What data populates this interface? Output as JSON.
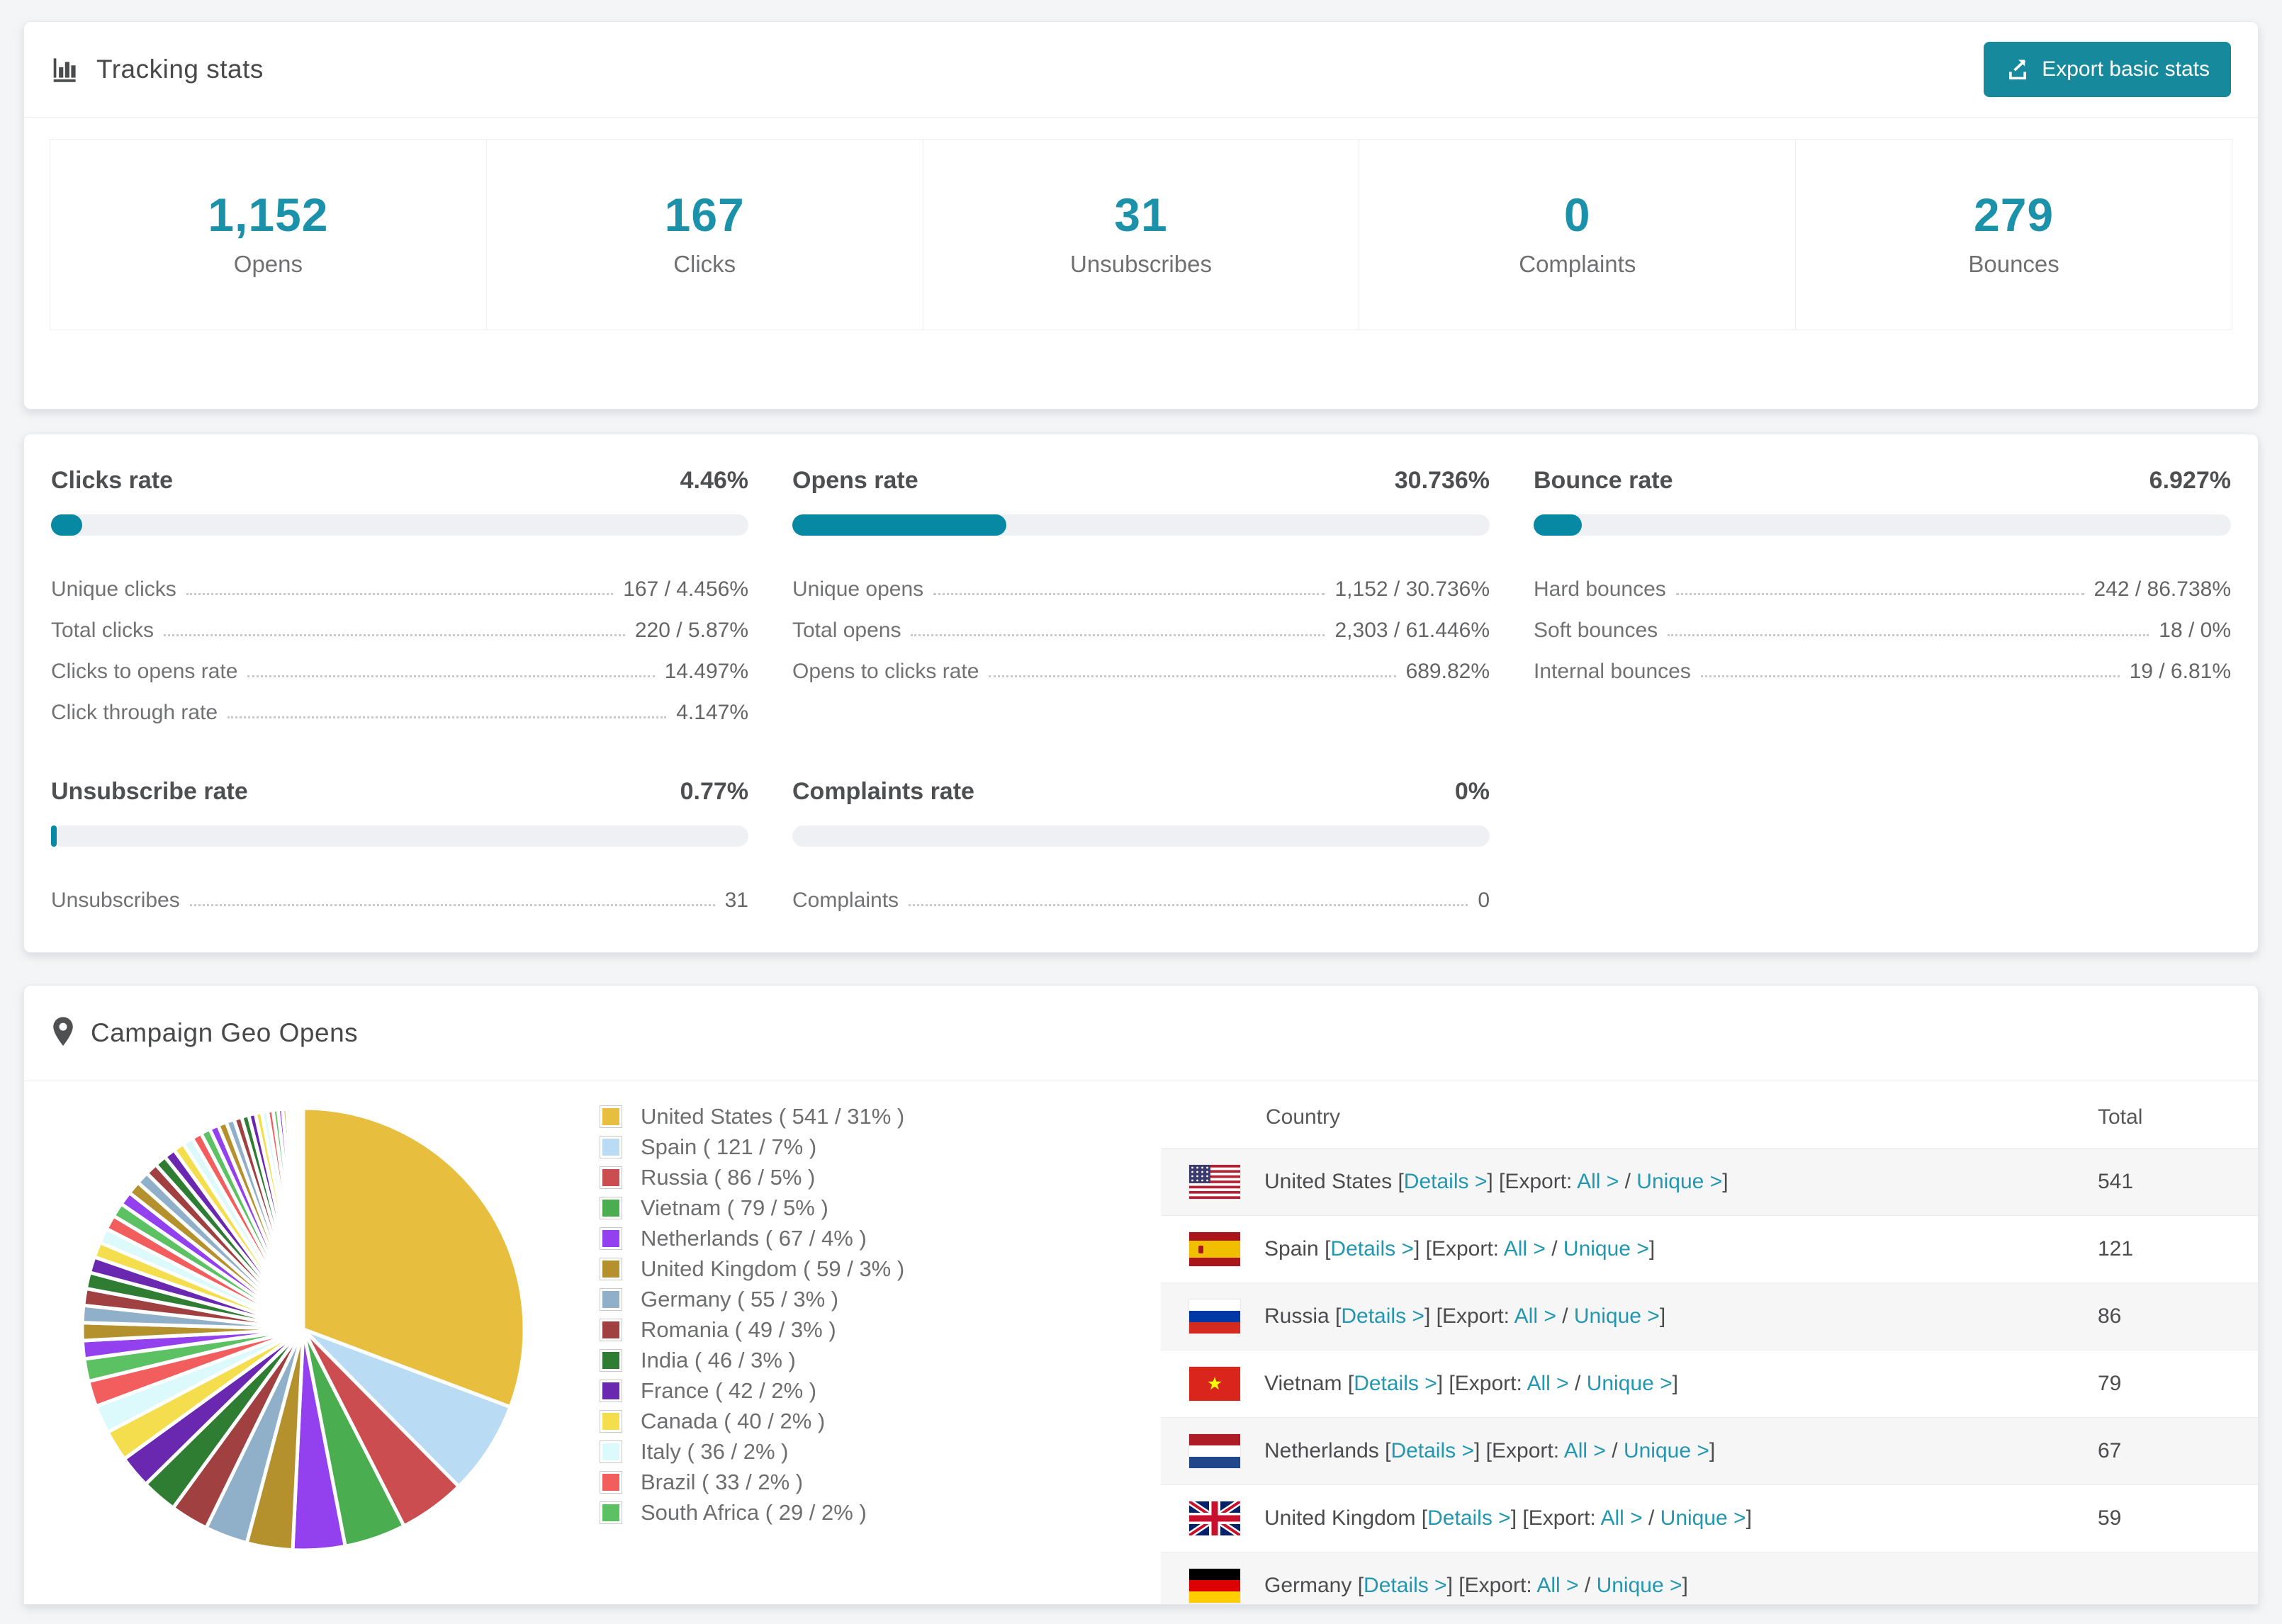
{
  "colors": {
    "accent": "#17899d",
    "stat_number": "#1b92a9",
    "bar_fill": "#0789a3",
    "bar_track": "#eef0f3",
    "link": "#2397b1",
    "page_bg": "#f4f5f7"
  },
  "tracking": {
    "title": "Tracking stats",
    "export_button": "Export basic stats",
    "stats": [
      {
        "value": "1,152",
        "label": "Opens"
      },
      {
        "value": "167",
        "label": "Clicks"
      },
      {
        "value": "31",
        "label": "Unsubscribes"
      },
      {
        "value": "0",
        "label": "Complaints"
      },
      {
        "value": "279",
        "label": "Bounces"
      }
    ]
  },
  "rates": {
    "sections": [
      {
        "id": "clicks",
        "title": "Clicks rate",
        "value": "4.46%",
        "bar_pct": 4.46,
        "rows": [
          {
            "label": "Unique clicks",
            "value": "167 / 4.456%"
          },
          {
            "label": "Total clicks",
            "value": "220 / 5.87%"
          },
          {
            "label": "Clicks to opens rate",
            "value": "14.497%"
          },
          {
            "label": "Click through rate",
            "value": "4.147%"
          }
        ]
      },
      {
        "id": "opens",
        "title": "Opens rate",
        "value": "30.736%",
        "bar_pct": 30.736,
        "rows": [
          {
            "label": "Unique opens",
            "value": "1,152 / 30.736%"
          },
          {
            "label": "Total opens",
            "value": "2,303 / 61.446%"
          },
          {
            "label": "Opens to clicks rate",
            "value": "689.82%"
          }
        ]
      },
      {
        "id": "bounce",
        "title": "Bounce rate",
        "value": "6.927%",
        "bar_pct": 6.927,
        "rows": [
          {
            "label": "Hard bounces",
            "value": "242 / 86.738%"
          },
          {
            "label": "Soft bounces",
            "value": "18 / 0%"
          },
          {
            "label": "Internal bounces",
            "value": "19 / 6.81%"
          }
        ]
      },
      {
        "id": "unsubscribe",
        "title": "Unsubscribe rate",
        "value": "0.77%",
        "bar_pct": 0.77,
        "rows": [
          {
            "label": "Unsubscribes",
            "value": "31"
          }
        ]
      },
      {
        "id": "complaints",
        "title": "Complaints rate",
        "value": "0%",
        "bar_pct": 0,
        "rows": [
          {
            "label": "Complaints",
            "value": "0"
          }
        ]
      }
    ]
  },
  "geo": {
    "title": "Campaign Geo Opens",
    "table": {
      "col_country": "Country",
      "col_total": "Total",
      "lb": "[",
      "rb": "]",
      "export_prefix": "Export:",
      "slash": "/",
      "link_details": "Details >",
      "link_all": "All >",
      "link_unique": "Unique >",
      "rows": [
        {
          "country": "United States",
          "flag": "us",
          "total": "541"
        },
        {
          "country": "Spain",
          "flag": "es",
          "total": "121"
        },
        {
          "country": "Russia",
          "flag": "ru",
          "total": "86"
        },
        {
          "country": "Vietnam",
          "flag": "vn",
          "total": "79"
        },
        {
          "country": "Netherlands",
          "flag": "nl",
          "total": "67"
        },
        {
          "country": "United Kingdom",
          "flag": "gb",
          "total": "59"
        },
        {
          "country": "Germany",
          "flag": "de",
          "total": ""
        }
      ]
    }
  },
  "chart_data": {
    "type": "pie",
    "title": "Campaign Geo Opens",
    "unit": "opens",
    "legend_position": "right",
    "series": [
      {
        "name": "United States",
        "value": 541,
        "pct": 31,
        "color": "#e8be3e"
      },
      {
        "name": "Spain",
        "value": 121,
        "pct": 7,
        "color": "#badbf4"
      },
      {
        "name": "Russia",
        "value": 86,
        "pct": 5,
        "color": "#cc4d50"
      },
      {
        "name": "Vietnam",
        "value": 79,
        "pct": 5,
        "color": "#4aad4f"
      },
      {
        "name": "Netherlands",
        "value": 67,
        "pct": 4,
        "color": "#9340ee"
      },
      {
        "name": "United Kingdom",
        "value": 59,
        "pct": 3,
        "color": "#b5912d"
      },
      {
        "name": "Germany",
        "value": 55,
        "pct": 3,
        "color": "#90b0c9"
      },
      {
        "name": "Romania",
        "value": 49,
        "pct": 3,
        "color": "#a04040"
      },
      {
        "name": "India",
        "value": 46,
        "pct": 3,
        "color": "#2e7d32"
      },
      {
        "name": "France",
        "value": 42,
        "pct": 2,
        "color": "#6a28b0"
      },
      {
        "name": "Canada",
        "value": 40,
        "pct": 2,
        "color": "#f4de4d"
      },
      {
        "name": "Italy",
        "value": 36,
        "pct": 2,
        "color": "#dcf9fb"
      },
      {
        "name": "Brazil",
        "value": 33,
        "pct": 2,
        "color": "#f25e5e"
      },
      {
        "name": "South Africa",
        "value": 29,
        "pct": 2,
        "color": "#5cc162"
      }
    ],
    "others_unlabeled": {
      "approx_total": 466,
      "approx_pct": 27,
      "slice_count_approx": 40
    }
  }
}
